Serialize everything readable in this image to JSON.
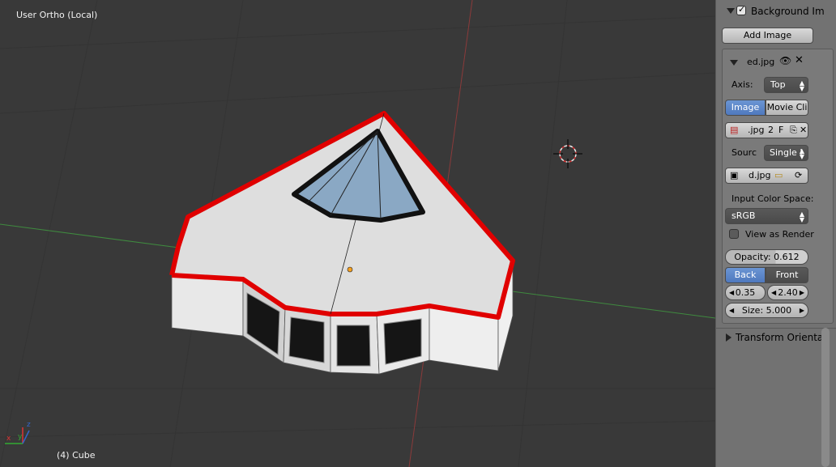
{
  "viewport": {
    "view_label": "User Ortho (Local)",
    "object_label": "(4) Cube",
    "axis_z": "z",
    "axis_y": "y",
    "axis_x": "x"
  },
  "panel": {
    "header": "Background Im",
    "add_image": "Add Image",
    "image_name": "ed.jpg",
    "axis_label": "Axis:",
    "axis_value": "Top",
    "tab_image": "Image",
    "tab_movie": "Movie Cli",
    "file_ext": ".jpg",
    "file_users": "2",
    "file_fake": "F",
    "source_label": "Sourc",
    "source_value": "Single I",
    "filepath": "d.jpg",
    "color_space_label": "Input Color Space:",
    "color_space_value": "sRGB",
    "view_as_render": "View as Render",
    "opacity": "Opacity: 0.612",
    "back": "Back",
    "front": "Front",
    "offset_x": "0.35",
    "offset_y": "2.40",
    "size": "Size: 5.000",
    "transform": "Transform Orientat"
  }
}
